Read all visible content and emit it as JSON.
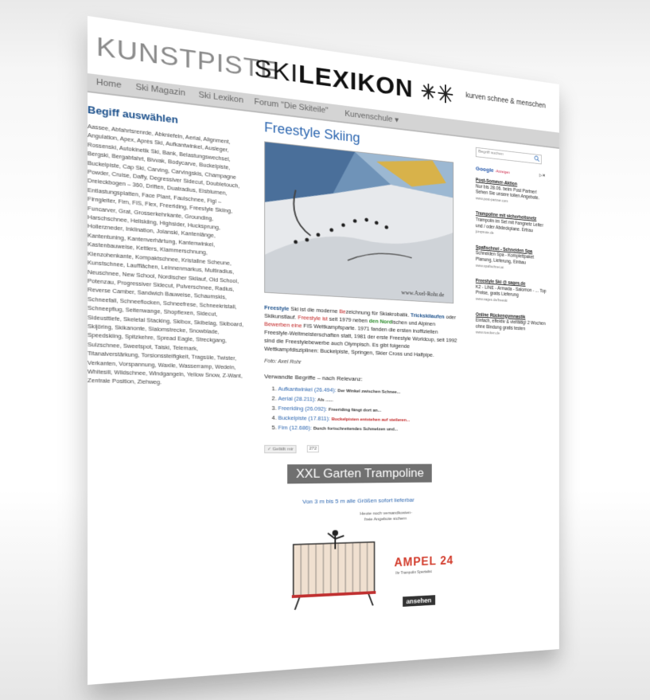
{
  "header": {
    "logo_part1": "KUNSTPISTE",
    "logo_part2a": "SKI",
    "logo_part2b": "LEXIKON",
    "tagline": "kurven schnee & menschen"
  },
  "nav": {
    "items": [
      "Home",
      "Ski Magazin",
      "Ski Lexikon",
      "Forum \"Die Skiteile\"",
      "Kurvenschule ▾"
    ]
  },
  "left": {
    "title": "Begiff auswählen",
    "terms": "Aassee, Abfahrtsrenrde, Abkniefeln, Aerial, Alignment, Angulation, Apex, Après Ski, Aufkantwinkel, Ausleger, Rossenski, Autokinetik Ski, Bank, Belastungswechsel, Bergski, Bergabfahrt, Bivvak, Bodycarve, Buckelpiste, Buckelpiste, Cap Ski, Carving, Carvingskis, Champagne Powder, Cruise, Daffy, Degressiver Sidecut, Doubletouch, Dreieckbogen – 360, Driften, Duatradius, Eisblumen, Entlastungsplatten, Face Plant, Faulschnee, Figl – Firngleiter, Firn, FIS, Flex, Freeriding, Freestyle Skiing, Funcarver, Grat, Grosserkehrkante, Grounding, Harschschnee, Heliskiing, Highsider, Hucksprung, Hollerzneder, Inklination, Jolanski, Kantenlänge, Kantentuning, Kantenverhärtung, Kantenwinkel, Kastenbauweise, Kettlers, Klammerschnung, Klenzohenkante, Kompaktschnee, Kristallne Scheune, Kunstschnee, Laufflächen, Leinnenmarkus, Multiradius, Neuschnee, New School, Nordischer Skilauf, Old School, Potenzau, Progressiver Sidecut, Pulverschnee, Radius, Reverse Camber, Sandwich Bauweise, Schaumskis, Schneefall, Schneeflocken, Schneefrese, Schneekristall, Schneepflug, Seitenwange, Shopflexen, Sidecut, Sideusttiefe, Skeletal Stacking, Skibox, Skibelag, Skiboard, Skijöring, Skikanonte, Slalomstrecke, Snowblade, Speedskiing, Spitzkehre, Spread Eagle, Streckgang, Sulzschnee, Sweetspot, Taiski, Telemark, Titanalverstärkung, Torsionssteifigkeit, Tragsüle, Twister, Verkanten, Vorspannung, Waxile, Wasserramp, Wedeln, Whitesill, Wildschnee, Windgangeln, Yellow Snow, Z-Want, Zentrale Position, Ziehweg."
  },
  "article": {
    "title": "Freestyle Skiing",
    "paragraph_parts": {
      "p1": "Freestyle",
      "p2": " Ski ist die moderne ",
      "p3": "Be",
      "p4": "zeichnung für Skiakrobatik. ",
      "p5": "Trickskilaufen",
      "p6": " oder Skikunstlauf. ",
      "p7": "Freestyle ist",
      "p8": " seit 1979 neben ",
      "p9": "den Nord",
      "p10": "ischen und Alpinen ",
      "p11": "Bewerben eine",
      "p12": " FIS Wettkampfsparte. 1971 fanden die ersten inoffiziellen Freestyle-Weltmeisterschaften statt, 1981 der erste Freestyle Worldcup, seit 1992 sind die Freestylebewerbe auch Olympisch. Es gibt folgende Wettkampfdisziplinen: Buckelpiste, Springen, Skier Cross und Halfpipe."
    },
    "credit": "Foto: Axel Rohr",
    "related_heading": "Verwandte Begriffe – nach Relevanz:",
    "related": [
      {
        "term": "Aufkantwinkel",
        "count": "(26.494):",
        "desc": "Der Winkel zwischen Schnee..."
      },
      {
        "term": "Aerial",
        "count": "(28.211):",
        "desc": "Als ......"
      },
      {
        "term": "Freeriding",
        "count": "(26.092):",
        "desc": "Freeriding fängt dort an..."
      },
      {
        "term": "Buckelpiste",
        "count": "(17.811):",
        "desc": "Buckelpisten entstehen auf steileren..."
      },
      {
        "term": "Firn",
        "count": "(12.686):",
        "desc": "Durch fortschreitendes Schmelzen und..."
      }
    ],
    "like_label": "✓ Gefällt mir",
    "like_count": "272",
    "image_signature": "www.Axel-Rohr.de"
  },
  "ad": {
    "banner": "XXL Garten Trampoline",
    "sub": "Von 3 m bis 5 m alle Größen sofort lieferbar",
    "small1": "Heute noch versandkosten-",
    "small2": "freie Angebote sichern",
    "brand": "AMPEL 24",
    "brand_sub": "Ihr Trampolin Spezialist",
    "button": "ansehen"
  },
  "right": {
    "search_placeholder": "Begriff suchen",
    "google_label": "Google",
    "ads_by": "-Anzeigen",
    "ad_mark": "▷✕",
    "ads": [
      {
        "head": "Post-Sommer-Aktion",
        "body": "Nur bis 28.06. beim Post Partner! Sehen Sie unsere tollen Angebote.",
        "url": "www.post-partner.com"
      },
      {
        "head": "Trampoline mit sicherheitsnetz",
        "body": "Trampolin im Set mit Fangnetz Leiter und / oder Abdeckplane. Ertrau",
        "url": "jumpman.de"
      },
      {
        "head": "Spafischnei - Schneiden Spa",
        "body": "Schneiden Spa - Komplettpaket Planung, Lieferung, Einbau",
        "url": "www.spafischnei.at"
      },
      {
        "head": "Freestyle Ski @ sages.de",
        "body": "K2 - LINE - Armada - Salomon - ... Top Preise, gratis Lieferung",
        "url": "www.sages.de/freeski"
      },
      {
        "head": "Online Rückengymnastik",
        "body": "Einfach, effektiv & vielfältig! 2 Wochen ohne Bindung gratis testen",
        "url": "www.ruecken.de"
      }
    ]
  },
  "colors": {
    "nav_bg": "#d4d4d4",
    "link": "#2c66b0",
    "title_blue": "#1a4f8b",
    "highlight_red": "#c02020",
    "brand_red": "#d23a2a"
  }
}
